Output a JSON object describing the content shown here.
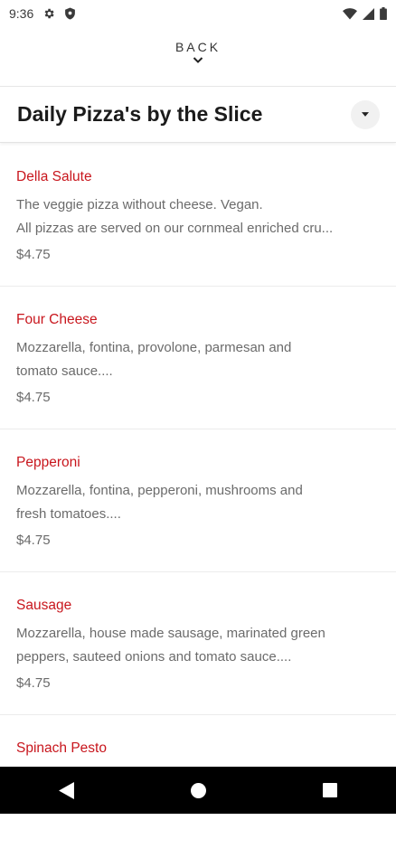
{
  "status_bar": {
    "time": "9:36",
    "icons": [
      "settings-icon",
      "shield-icon",
      "wifi-icon",
      "signal-icon",
      "battery-icon"
    ]
  },
  "back": {
    "label": "BACK"
  },
  "header": {
    "title": "Daily Pizza's by the Slice"
  },
  "colors": {
    "accent": "#c8161d",
    "text_secondary": "#6b6b6b"
  },
  "menu_items": [
    {
      "name": "Della Salute",
      "description": "The veggie pizza without cheese. Vegan.\nAll pizzas are served on our cornmeal enriched cru...",
      "price": "$4.75"
    },
    {
      "name": "Four Cheese",
      "description": "Mozzarella, fontina, provolone, parmesan and\ntomato sauce....",
      "price": "$4.75"
    },
    {
      "name": "Pepperoni",
      "description": "Mozzarella, fontina, pepperoni, mushrooms and\nfresh tomatoes....",
      "price": "$4.75"
    },
    {
      "name": "Sausage",
      "description": "Mozzarella, house made sausage, marinated green\npeppers, sauteed onions and tomato sauce....",
      "price": "$4.75"
    },
    {
      "name": "Spinach Pesto",
      "description": "",
      "price": ""
    }
  ],
  "nav_bar": {
    "buttons": [
      "back-nav-icon",
      "home-nav-icon",
      "recents-nav-icon"
    ]
  }
}
